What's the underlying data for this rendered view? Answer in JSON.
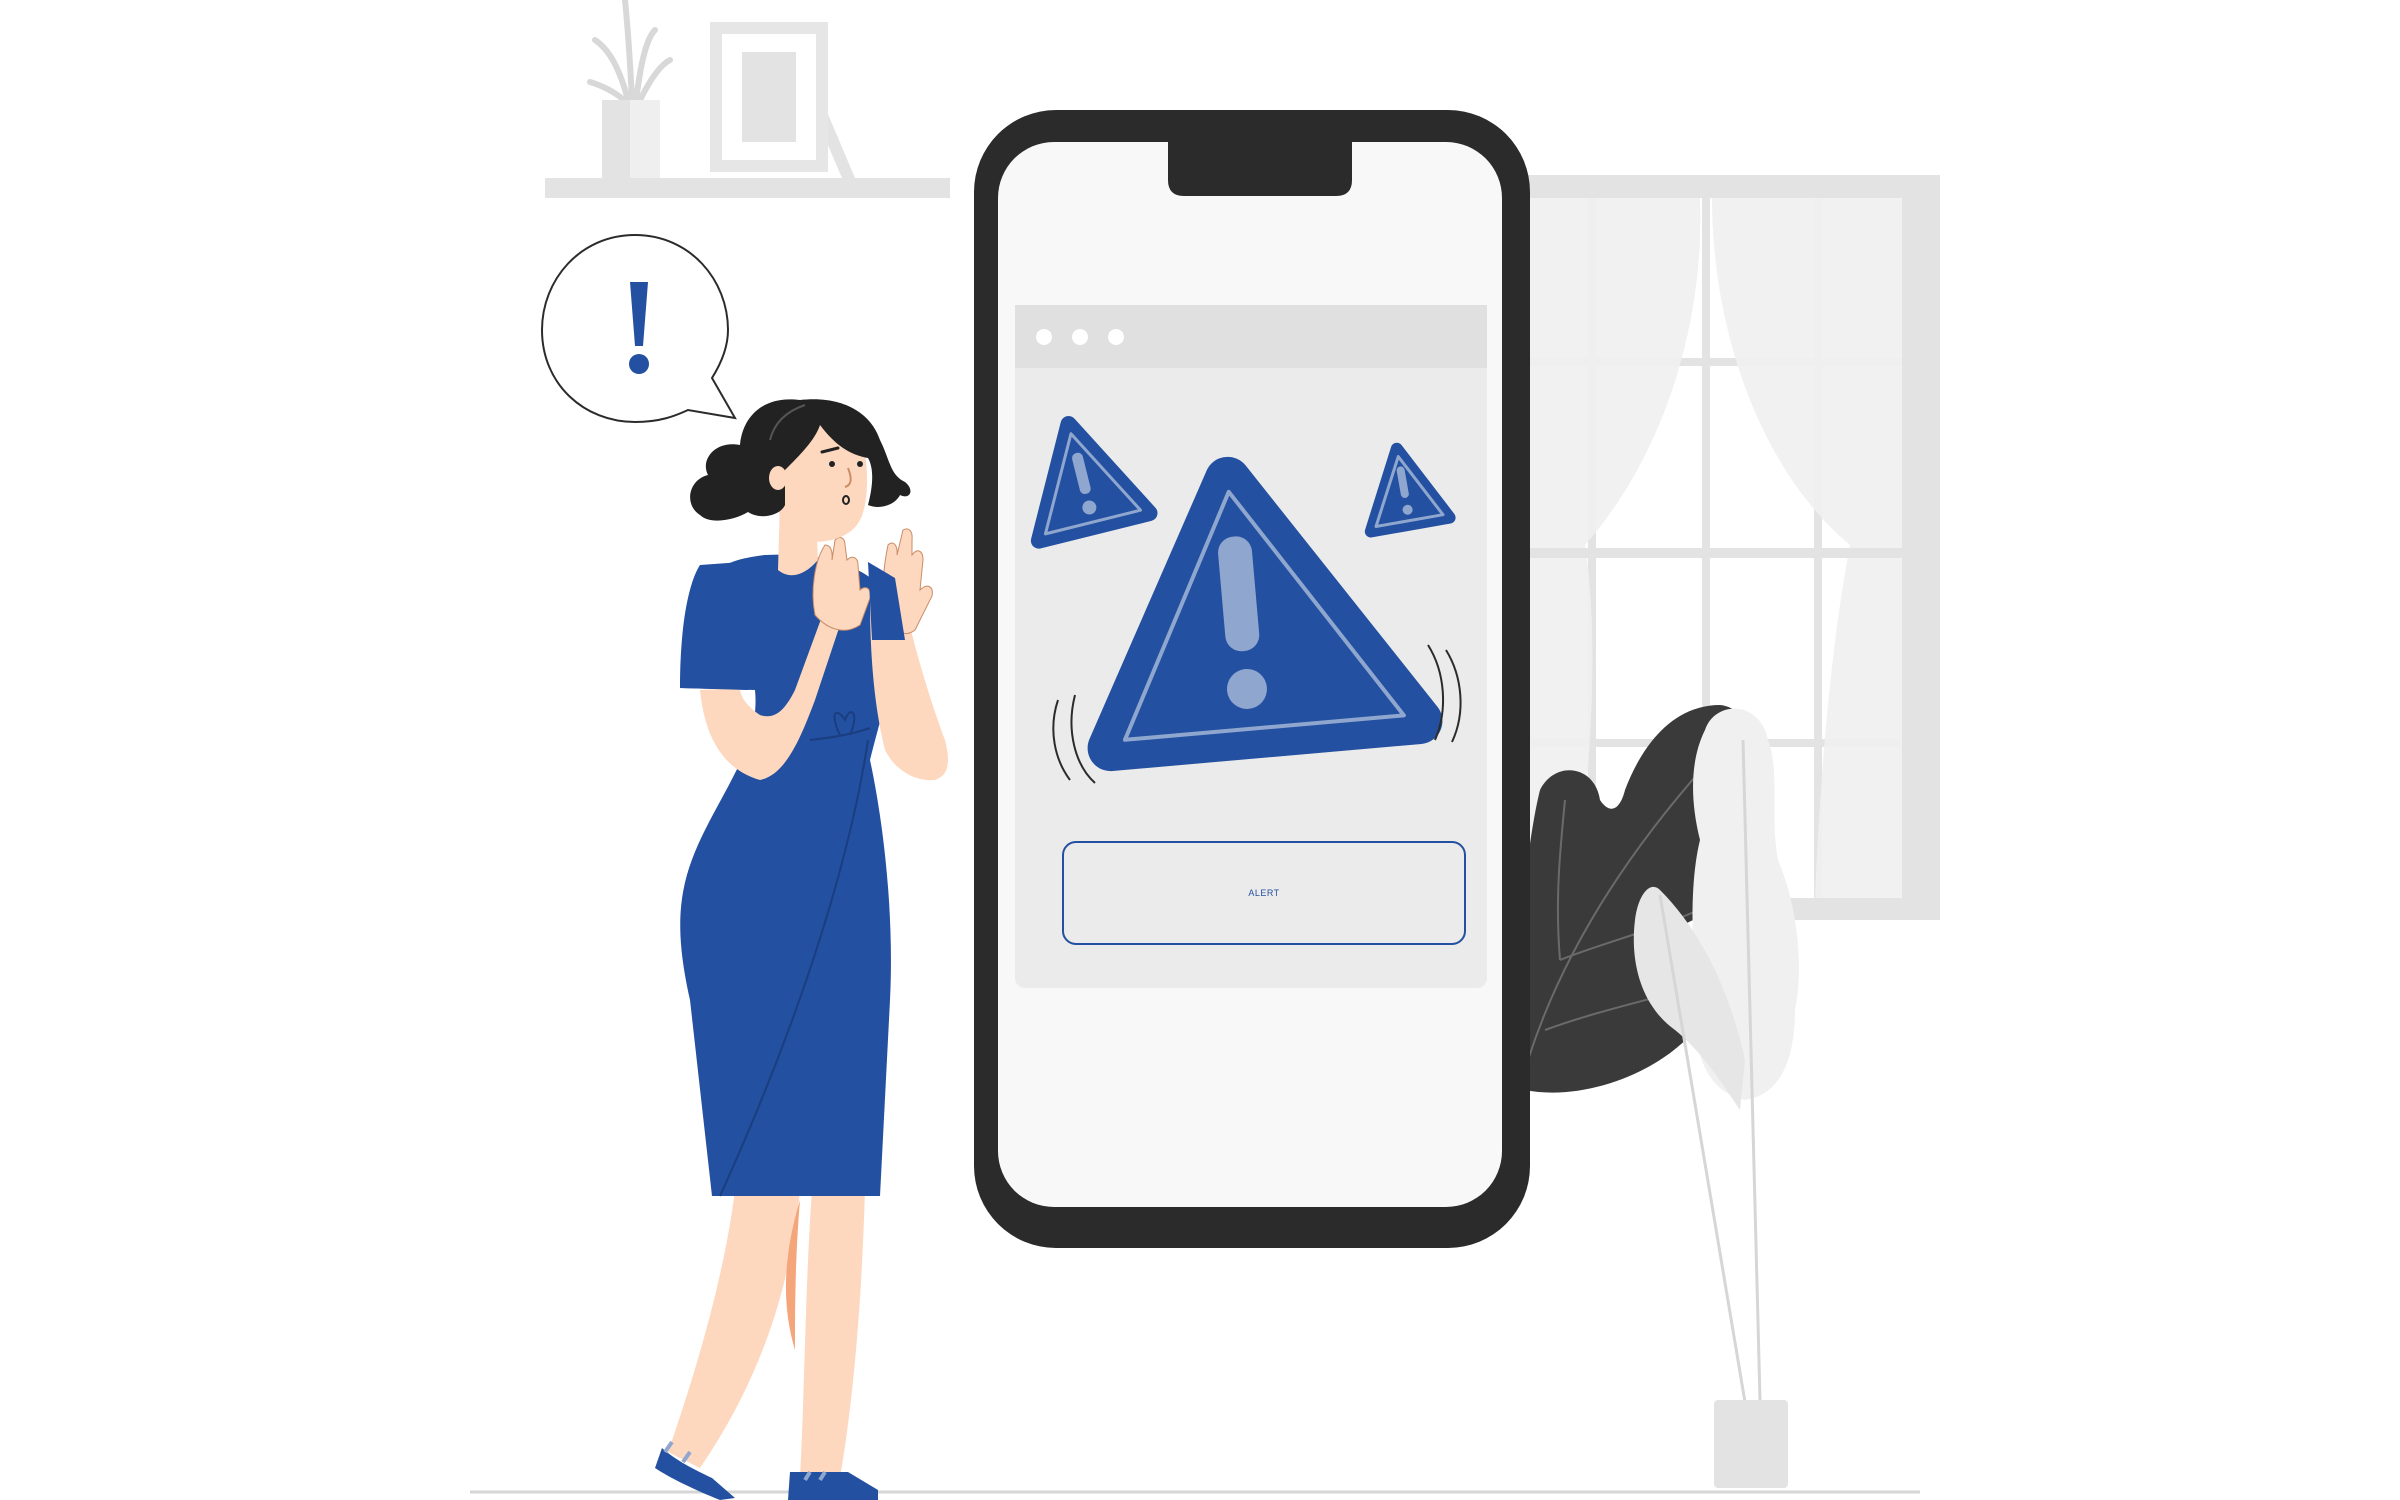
{
  "colors": {
    "accent": "#2350a0",
    "phone_frame": "#2b2b2b",
    "screen": "#f8f8f8",
    "window_panel": "#ebebeb",
    "skin": "#fdd8bf",
    "leaf_dark": "#3a3a3a",
    "background_gray": "#e3e3e3"
  },
  "screen": {
    "alert_button_label": "ALERT",
    "browser_dots": 3
  },
  "icons": {
    "speech_bubble": "exclamation-icon",
    "warnings": [
      "warning-triangle-icon",
      "warning-triangle-icon",
      "warning-triangle-icon"
    ]
  }
}
